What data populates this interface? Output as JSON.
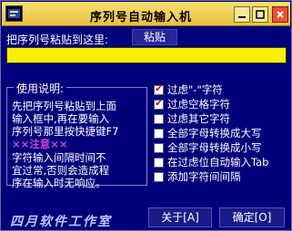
{
  "window": {
    "title": "序列号自动输入机",
    "icon": "app-icon",
    "controls": {
      "minimize": "minimize-icon",
      "maximize": "maximize-icon",
      "close": "close-icon"
    }
  },
  "paste": {
    "label": "把序列号粘贴到这里:",
    "button_label": "粘贴",
    "value": ""
  },
  "help": {
    "legend": "使用说明:",
    "lines": [
      "先把序列号粘贴到上面",
      "输入框中,再在要输入",
      "序列号那里按快捷键F7"
    ],
    "warning": "××注意××",
    "notes": [
      "字符输入间隔时间不",
      "宜过常,否则会造成程",
      "序在输入时无响应。"
    ]
  },
  "options": [
    {
      "label": "过虑\"-\"字符",
      "checked": true
    },
    {
      "label": "过虑空格字符",
      "checked": true
    },
    {
      "label": "过虑其它字符",
      "checked": false
    },
    {
      "label": "全部字母转换成大写",
      "checked": false
    },
    {
      "label": "全部字母转换成小写",
      "checked": false
    },
    {
      "label": "在过虑位自动输入Tab",
      "checked": false
    },
    {
      "label": "添加字符间间隔",
      "checked": false
    }
  ],
  "footer": {
    "brand": "四月软件工作室",
    "about_label": "关于[A]",
    "ok_label": "确定[O]"
  },
  "colors": {
    "background": "#00007a",
    "titlebar": "#e8c040",
    "input": "#f8f000",
    "warning": "#d040d0"
  }
}
